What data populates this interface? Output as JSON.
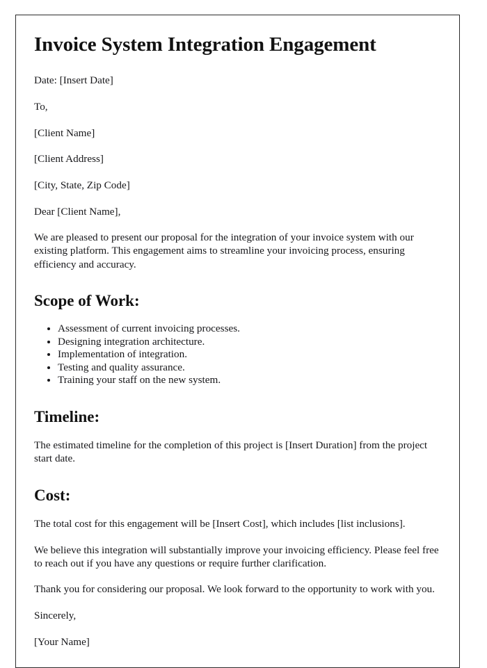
{
  "document": {
    "title": "Invoice System Integration Engagement",
    "date_line": "Date: [Insert Date]",
    "recipient": {
      "to_label": "To,",
      "client_name": "[Client Name]",
      "client_address": "[Client Address]",
      "client_city_state_zip": "[City, State, Zip Code]",
      "salutation": "Dear [Client Name],"
    },
    "intro_paragraph": "We are pleased to present our proposal for the integration of your invoice system with our existing platform. This engagement aims to streamline your invoicing process, ensuring efficiency and accuracy.",
    "sections": [
      {
        "heading": "Scope of Work:",
        "bullets": [
          "Assessment of current invoicing processes.",
          "Designing integration architecture.",
          "Implementation of integration.",
          "Testing and quality assurance.",
          "Training your staff on the new system."
        ]
      },
      {
        "heading": "Timeline:",
        "paragraph": "The estimated timeline for the completion of this project is [Insert Duration] from the project start date."
      },
      {
        "heading": "Cost:",
        "paragraph": "The total cost for this engagement will be [Insert Cost], which includes [list inclusions]."
      }
    ],
    "closing": {
      "benefit_paragraph": "We believe this integration will substantially improve your invoicing efficiency. Please feel free to reach out if you have any questions or require further clarification.",
      "thanks_paragraph": "Thank you for considering our proposal. We look forward to the opportunity to work with you.",
      "sign_off": "Sincerely,",
      "sender_name": "[Your Name]"
    }
  },
  "colors": {
    "page_background": "#ffffff",
    "page_border": "#2b2b2b",
    "heading_text": "#121212",
    "body_text": "#17171a"
  }
}
